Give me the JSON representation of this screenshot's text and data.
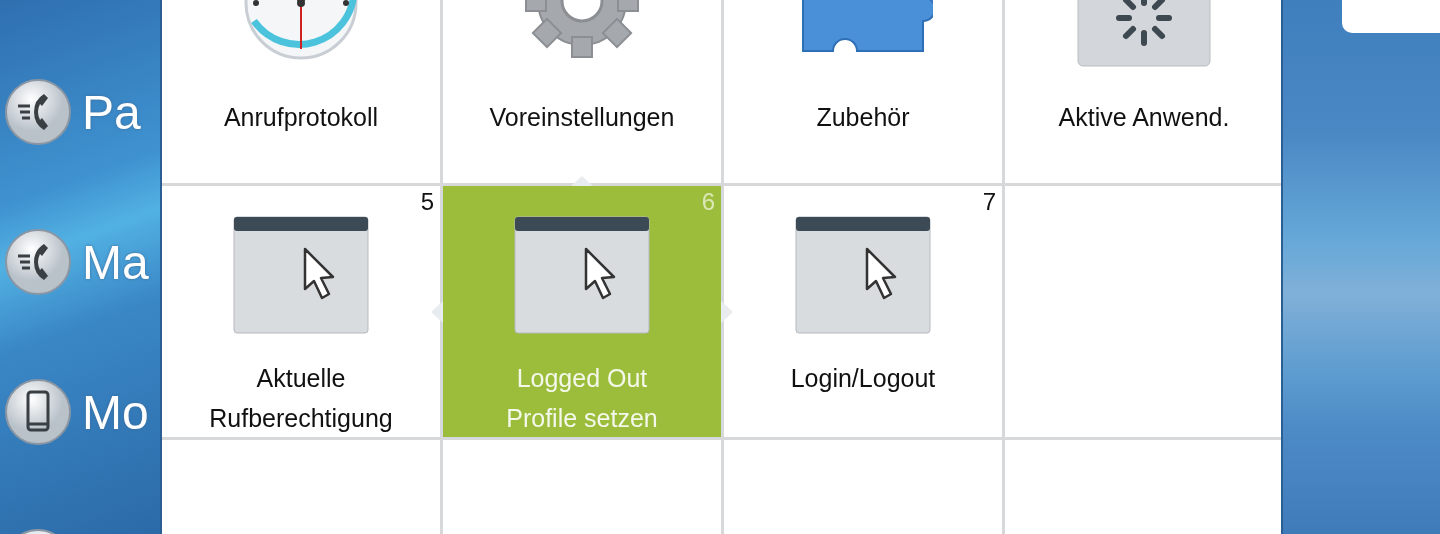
{
  "sidebar": {
    "items": [
      {
        "label": "Pa"
      },
      {
        "label": "Ma"
      },
      {
        "label": "Mo"
      }
    ]
  },
  "grid": {
    "cells": [
      {
        "kind": "app",
        "label": "Anrufprotokoll",
        "selected": false
      },
      {
        "kind": "app",
        "label": "Voreinstellungen",
        "selected": false
      },
      {
        "kind": "app",
        "label": "Zubehör",
        "selected": false
      },
      {
        "kind": "app",
        "label": "Aktive Anwend.",
        "selected": false
      },
      {
        "kind": "app",
        "label": "Aktuelle\nRufberechtigung",
        "badge": "5",
        "selected": false
      },
      {
        "kind": "app",
        "label": "Logged Out\nProfile setzen",
        "badge": "6",
        "selected": true
      },
      {
        "kind": "app",
        "label": "Login/Logout",
        "badge": "7",
        "selected": false
      }
    ]
  }
}
